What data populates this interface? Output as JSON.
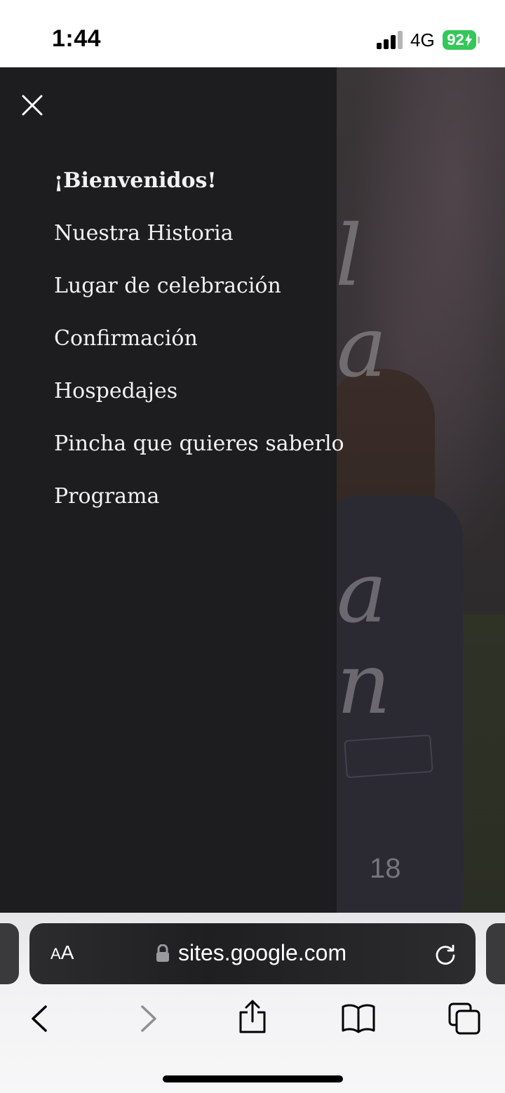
{
  "status_bar": {
    "time": "1:44",
    "network": "4G",
    "battery_level": "92"
  },
  "drawer": {
    "menu_items": [
      {
        "label": "¡Bienvenidos!",
        "active": true
      },
      {
        "label": "Nuestra Historia",
        "active": false
      },
      {
        "label": "Lugar de celebración",
        "active": false
      },
      {
        "label": "Confirmación",
        "active": false
      },
      {
        "label": "Hospedajes",
        "active": false
      },
      {
        "label": "Pincha que quieres saberlo",
        "active": false
      },
      {
        "label": "Programa",
        "active": false
      }
    ]
  },
  "background_page": {
    "number": "18"
  },
  "safari": {
    "reader_label_small": "A",
    "reader_label_large": "A",
    "url": "sites.google.com"
  },
  "colors": {
    "drawer_bg": "#1d1c1e",
    "menu_text": "#f2f2f2",
    "battery_green": "#34c759"
  }
}
